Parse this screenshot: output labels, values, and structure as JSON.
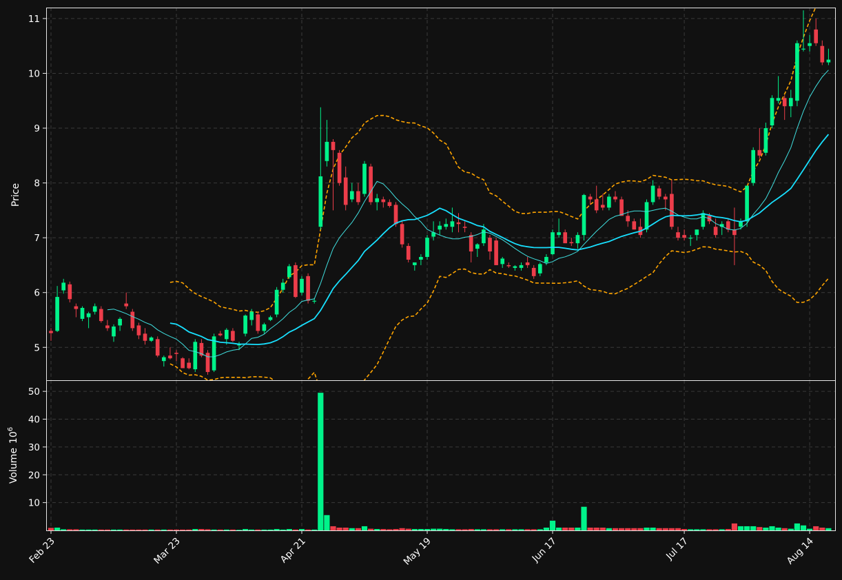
{
  "chart_data": {
    "type": "candlestick",
    "ylabel": "Price",
    "volume_label": "Volume",
    "volume_exponent_base": "10",
    "volume_exponent": "6",
    "ylim": [
      4.4,
      11.2
    ],
    "y_ticks": [
      5,
      6,
      7,
      8,
      9,
      10,
      11
    ],
    "volume_ylim": [
      0,
      54
    ],
    "volume_ticks": [
      10,
      20,
      30,
      40,
      50
    ],
    "x_ticks": [
      {
        "index": 0,
        "label": "Feb 23"
      },
      {
        "index": 20,
        "label": "Mar 23"
      },
      {
        "index": 40,
        "label": "Apr 21"
      },
      {
        "index": 60,
        "label": "May 19"
      },
      {
        "index": 80,
        "label": "Jun 17"
      },
      {
        "index": 101,
        "label": "Jul 17"
      },
      {
        "index": 121,
        "label": "Aug 14"
      }
    ],
    "grid": true,
    "colors": {
      "up": "#00f38a",
      "down": "#ec3d4a",
      "ma_short": "#40e0e0",
      "ma_long": "#18e0ff",
      "bands": "#ffa500",
      "background": "#111111",
      "grid": "#3a3a3a"
    },
    "candles": [
      [
        5.3,
        5.35,
        5.12,
        5.26,
        0.9
      ],
      [
        5.3,
        6.12,
        5.28,
        5.92,
        1.0
      ],
      [
        6.04,
        6.25,
        5.98,
        6.18,
        0.4
      ],
      [
        6.15,
        6.2,
        5.82,
        5.88,
        0.4
      ],
      [
        5.75,
        5.8,
        5.55,
        5.7,
        0.4
      ],
      [
        5.52,
        5.75,
        5.48,
        5.72,
        0.3
      ],
      [
        5.55,
        5.65,
        5.35,
        5.62,
        0.3
      ],
      [
        5.65,
        5.8,
        5.6,
        5.75,
        0.3
      ],
      [
        5.7,
        5.75,
        5.45,
        5.48,
        0.3
      ],
      [
        5.4,
        5.5,
        5.3,
        5.35,
        0.3
      ],
      [
        5.2,
        5.42,
        5.1,
        5.38,
        0.3
      ],
      [
        5.4,
        5.55,
        5.3,
        5.52,
        0.3
      ],
      [
        5.8,
        6.0,
        5.7,
        5.75,
        0.3
      ],
      [
        5.65,
        5.7,
        5.3,
        5.35,
        0.3
      ],
      [
        5.4,
        5.45,
        5.15,
        5.22,
        0.3
      ],
      [
        5.25,
        5.35,
        5.05,
        5.12,
        0.3
      ],
      [
        5.12,
        5.2,
        5.1,
        5.18,
        0.3
      ],
      [
        5.15,
        5.2,
        4.82,
        4.85,
        0.3
      ],
      [
        4.75,
        4.85,
        4.65,
        4.82,
        0.3
      ],
      [
        4.85,
        5.0,
        4.78,
        4.8,
        0.3
      ],
      [
        4.9,
        4.95,
        4.75,
        4.88,
        0.3
      ],
      [
        4.8,
        4.82,
        4.62,
        4.62,
        0.3
      ],
      [
        4.72,
        4.8,
        4.6,
        4.62,
        0.3
      ],
      [
        4.6,
        5.15,
        4.55,
        5.1,
        0.5
      ],
      [
        5.08,
        5.15,
        4.82,
        4.85,
        0.5
      ],
      [
        4.9,
        4.95,
        4.5,
        4.55,
        0.4
      ],
      [
        4.58,
        5.25,
        4.55,
        5.2,
        0.3
      ],
      [
        5.25,
        5.3,
        5.2,
        5.22,
        0.3
      ],
      [
        5.15,
        5.35,
        5.05,
        5.32,
        0.3
      ],
      [
        5.3,
        5.35,
        5.1,
        5.12,
        0.3
      ],
      [
        5.05,
        5.1,
        4.95,
        5.05,
        0.2
      ],
      [
        5.25,
        5.6,
        5.2,
        5.58,
        0.5
      ],
      [
        5.5,
        5.7,
        5.4,
        5.65,
        0.3
      ],
      [
        5.6,
        5.65,
        5.25,
        5.3,
        0.3
      ],
      [
        5.3,
        5.45,
        5.25,
        5.42,
        0.3
      ],
      [
        5.5,
        5.58,
        5.48,
        5.55,
        0.3
      ],
      [
        5.6,
        6.1,
        5.55,
        6.05,
        0.5
      ],
      [
        6.05,
        6.25,
        6.0,
        6.18,
        0.3
      ],
      [
        6.28,
        6.52,
        6.25,
        6.48,
        0.5
      ],
      [
        6.5,
        6.55,
        5.9,
        5.92,
        0.3
      ],
      [
        6.0,
        6.3,
        5.95,
        6.25,
        0.5
      ],
      [
        6.3,
        6.35,
        5.8,
        5.85,
        0.3
      ],
      [
        5.85,
        5.9,
        5.8,
        5.85,
        0.3
      ],
      [
        7.2,
        9.38,
        7.15,
        8.12,
        49.5
      ],
      [
        8.4,
        9.15,
        8.3,
        8.75,
        5.5
      ],
      [
        8.75,
        8.8,
        7.5,
        8.6,
        1.5
      ],
      [
        8.55,
        8.6,
        7.95,
        8.0,
        1.0
      ],
      [
        8.1,
        8.3,
        7.5,
        7.6,
        1.0
      ],
      [
        7.7,
        8.0,
        7.65,
        7.85,
        0.8
      ],
      [
        7.85,
        8.0,
        7.6,
        7.65,
        0.8
      ],
      [
        7.8,
        8.4,
        7.75,
        8.35,
        1.5
      ],
      [
        8.3,
        8.35,
        7.6,
        7.65,
        0.6
      ],
      [
        7.65,
        7.8,
        7.5,
        7.72,
        0.5
      ],
      [
        7.7,
        7.75,
        7.55,
        7.65,
        0.5
      ],
      [
        7.65,
        7.7,
        7.55,
        7.58,
        0.4
      ],
      [
        7.6,
        7.65,
        7.2,
        7.25,
        0.5
      ],
      [
        7.25,
        7.3,
        6.82,
        6.88,
        0.8
      ],
      [
        6.85,
        6.9,
        6.55,
        6.6,
        0.6
      ],
      [
        6.5,
        6.55,
        6.4,
        6.55,
        0.5
      ],
      [
        6.6,
        6.7,
        6.5,
        6.65,
        0.5
      ],
      [
        6.65,
        7.05,
        6.6,
        7.0,
        0.5
      ],
      [
        7.02,
        7.3,
        6.95,
        7.1,
        0.6
      ],
      [
        7.15,
        7.3,
        7.05,
        7.22,
        0.6
      ],
      [
        7.2,
        7.35,
        7.15,
        7.25,
        0.5
      ],
      [
        7.2,
        7.55,
        7.1,
        7.3,
        0.4
      ],
      [
        7.28,
        7.45,
        7.1,
        7.25,
        0.4
      ],
      [
        7.2,
        7.3,
        7.1,
        7.18,
        0.4
      ],
      [
        7.05,
        7.1,
        6.55,
        6.75,
        0.5
      ],
      [
        6.8,
        6.9,
        6.65,
        6.88,
        0.4
      ],
      [
        6.9,
        7.25,
        6.85,
        7.15,
        0.4
      ],
      [
        7.0,
        7.05,
        6.6,
        6.75,
        0.4
      ],
      [
        6.95,
        7.0,
        6.5,
        6.5,
        0.4
      ],
      [
        6.52,
        6.65,
        6.45,
        6.62,
        0.4
      ],
      [
        6.5,
        6.55,
        6.45,
        6.48,
        0.4
      ],
      [
        6.45,
        6.5,
        6.4,
        6.48,
        0.4
      ],
      [
        6.45,
        6.55,
        6.4,
        6.5,
        0.4
      ],
      [
        6.55,
        6.65,
        6.45,
        6.5,
        0.4
      ],
      [
        6.45,
        6.5,
        6.25,
        6.3,
        0.4
      ],
      [
        6.35,
        6.55,
        6.3,
        6.52,
        0.4
      ],
      [
        6.55,
        6.7,
        6.5,
        6.65,
        1.0
      ],
      [
        6.7,
        7.15,
        6.68,
        7.1,
        3.5
      ],
      [
        7.05,
        7.35,
        7.0,
        7.1,
        1.0
      ],
      [
        7.1,
        7.15,
        6.9,
        6.9,
        1.0
      ],
      [
        6.92,
        7.0,
        6.85,
        6.9,
        1.0
      ],
      [
        6.9,
        7.1,
        6.8,
        7.05,
        1.0
      ],
      [
        7.05,
        7.8,
        6.95,
        7.78,
        8.5
      ],
      [
        7.75,
        7.8,
        7.6,
        7.7,
        1.0
      ],
      [
        7.7,
        7.95,
        7.45,
        7.5,
        1.0
      ],
      [
        7.6,
        7.8,
        7.5,
        7.55,
        1.0
      ],
      [
        7.55,
        7.8,
        7.5,
        7.75,
        0.8
      ],
      [
        7.75,
        7.85,
        7.65,
        7.7,
        0.8
      ],
      [
        7.7,
        7.75,
        7.4,
        7.4,
        0.8
      ],
      [
        7.4,
        7.5,
        7.2,
        7.3,
        0.8
      ],
      [
        7.3,
        7.35,
        7.15,
        7.15,
        0.8
      ],
      [
        7.2,
        7.35,
        7.0,
        7.05,
        0.8
      ],
      [
        7.15,
        7.7,
        7.1,
        7.65,
        1.0
      ],
      [
        7.65,
        8.05,
        7.6,
        7.95,
        1.0
      ],
      [
        7.9,
        7.95,
        7.7,
        7.75,
        0.8
      ],
      [
        7.75,
        7.8,
        7.5,
        7.7,
        0.8
      ],
      [
        7.8,
        8.05,
        7.15,
        7.2,
        0.8
      ],
      [
        7.1,
        7.2,
        6.95,
        7.0,
        0.8
      ],
      [
        7.05,
        7.15,
        6.95,
        7.0,
        0.5
      ],
      [
        7.0,
        7.05,
        6.85,
        7.0,
        0.4
      ],
      [
        7.05,
        7.15,
        6.95,
        7.15,
        0.4
      ],
      [
        7.2,
        7.5,
        7.15,
        7.45,
        0.4
      ],
      [
        7.4,
        7.45,
        7.25,
        7.3,
        0.4
      ],
      [
        7.2,
        7.35,
        7.0,
        7.05,
        0.4
      ],
      [
        7.2,
        7.3,
        7.05,
        7.25,
        0.4
      ],
      [
        7.3,
        7.35,
        7.1,
        7.15,
        0.5
      ],
      [
        7.15,
        7.55,
        6.5,
        7.05,
        2.5
      ],
      [
        7.2,
        7.35,
        7.15,
        7.3,
        1.5
      ],
      [
        7.3,
        7.95,
        7.2,
        7.95,
        1.5
      ],
      [
        8.0,
        8.65,
        7.95,
        8.6,
        1.5
      ],
      [
        8.6,
        9.0,
        8.45,
        8.5,
        1.2
      ],
      [
        8.55,
        9.1,
        8.5,
        9.0,
        1.0
      ],
      [
        9.05,
        9.6,
        9.0,
        9.55,
        1.5
      ],
      [
        9.5,
        9.95,
        9.45,
        9.55,
        1.0
      ],
      [
        9.55,
        9.6,
        9.15,
        9.4,
        0.8
      ],
      [
        9.4,
        9.7,
        9.2,
        9.55,
        0.6
      ],
      [
        9.5,
        10.6,
        9.4,
        10.55,
        2.5
      ],
      [
        10.45,
        11.15,
        10.4,
        10.45,
        1.8
      ],
      [
        10.5,
        10.7,
        10.4,
        10.55,
        0.6
      ],
      [
        10.8,
        11.0,
        10.5,
        10.55,
        1.5
      ],
      [
        10.5,
        10.6,
        10.15,
        10.2,
        1.0
      ],
      [
        10.2,
        10.45,
        10.15,
        10.25,
        0.8
      ]
    ]
  }
}
